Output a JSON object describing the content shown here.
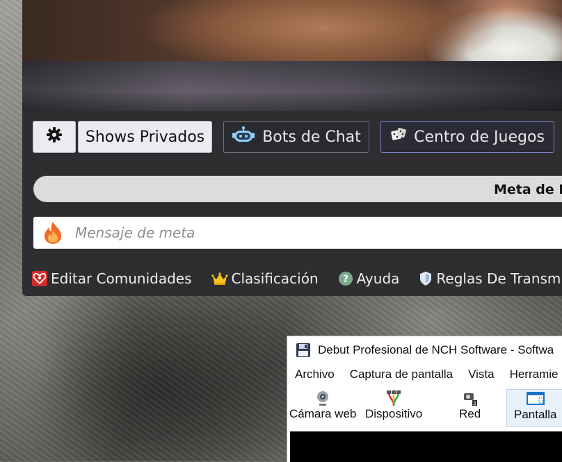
{
  "broadcast_panel": {
    "settings_icon": "gear-icon",
    "shows_privados_label": "Shows Privados",
    "bots_de_chat_label": "Bots de Chat",
    "bots_icon": "robot-icon",
    "centro_de_juegos_label": "Centro de Juegos",
    "juegos_icon": "dice-icon",
    "goal_bar_label": "Meta de Fich",
    "goal_input_placeholder": "Mensaje de meta",
    "goal_icon": "flame-icon",
    "links": [
      {
        "label": "Editar Comunidades",
        "icon": "heart-people-icon"
      },
      {
        "label": "Clasificación",
        "icon": "crown-icon"
      },
      {
        "label": "Ayuda",
        "icon": "help-circle-icon"
      },
      {
        "label": "Reglas De Transmi",
        "icon": "shield-icon"
      }
    ]
  },
  "debut_window": {
    "title": "Debut Profesional de NCH Software - Softwa",
    "app_icon": "floppy-disk-icon",
    "menu": [
      "Archivo",
      "Captura de pantalla",
      "Vista",
      "Herramie"
    ],
    "toolbar": [
      {
        "label": "Cámara web",
        "icon": "webcam-icon"
      },
      {
        "label": "Dispositivo",
        "icon": "rca-cable-icon"
      },
      {
        "label": "Red",
        "icon": "network-camera-icon"
      },
      {
        "label": "Pantalla",
        "icon": "screen-icon",
        "selected": true
      }
    ]
  },
  "colors": {
    "panel_bg": "#2e2e30",
    "accent_border": "#7a80c8",
    "goal_input_bg": "#ffffff"
  }
}
